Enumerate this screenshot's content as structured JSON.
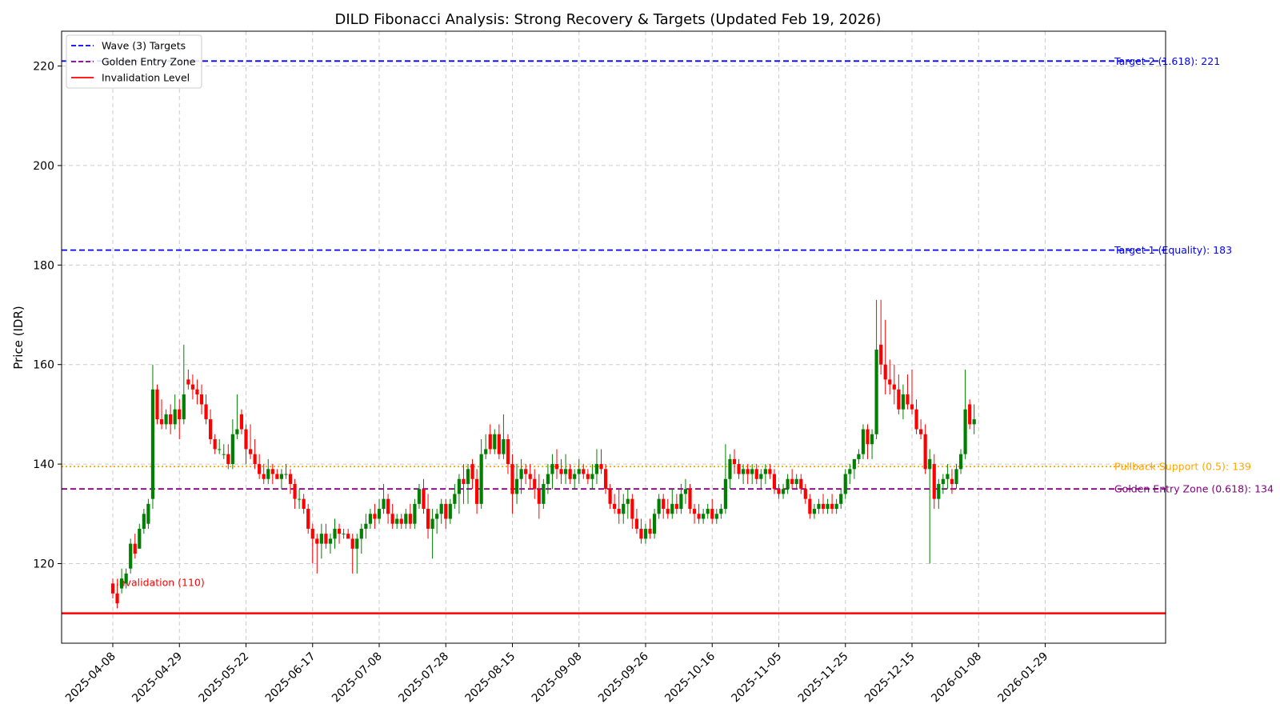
{
  "chart_data": {
    "type": "candlestick",
    "title": "DILD Fibonacci Analysis: Strong Recovery & Targets (Updated Feb 19, 2026)",
    "xlabel": "",
    "ylabel": "Price (IDR)",
    "ylim": [
      104,
      227
    ],
    "yticks": [
      120,
      140,
      160,
      180,
      200,
      220
    ],
    "grid": true,
    "legend_position": "top-left",
    "legend": [
      {
        "label": "Wave (3) Targets",
        "color": "#0000ff",
        "style": "dashed"
      },
      {
        "label": "Golden Entry Zone",
        "color": "#800080",
        "style": "dashed"
      },
      {
        "label": "Invalidation Level",
        "color": "#ff0000",
        "style": "solid"
      }
    ],
    "x_ticks": [
      "2025-04-08",
      "2025-04-29",
      "2025-05-22",
      "2025-06-17",
      "2025-07-08",
      "2025-07-28",
      "2025-08-15",
      "2025-09-08",
      "2025-09-26",
      "2025-10-16",
      "2025-11-05",
      "2025-11-25",
      "2025-12-15",
      "2026-01-08",
      "2026-01-29"
    ],
    "x_tick_trading_index": [
      0,
      15,
      30,
      45,
      60,
      75,
      90,
      105,
      120,
      135,
      150,
      165,
      180,
      195,
      210
    ],
    "horizontal_lines": [
      {
        "value": 221,
        "label": "Target 2 (1.618): 221",
        "color": "#0000ff",
        "style": "dashed"
      },
      {
        "value": 183,
        "label": "Target 1 (Equality): 183",
        "color": "#0000ff",
        "style": "dashed"
      },
      {
        "value": 139.5,
        "label": "Pullback Support (0.5): 139",
        "color": "#ffa500",
        "style": "dotted"
      },
      {
        "value": 135,
        "label": "Golden Entry Zone (0.618): 134",
        "color": "#800080",
        "style": "dashed"
      },
      {
        "value": 110,
        "label": "Invalidation (110)",
        "color": "#ff0000",
        "style": "solid"
      }
    ],
    "colors": {
      "up": "#008000",
      "down": "#ff0000"
    },
    "ohlc": [
      [
        116,
        117,
        113,
        114
      ],
      [
        114,
        116,
        111,
        112
      ],
      [
        115,
        119,
        114,
        117
      ],
      [
        116,
        119,
        115,
        118
      ],
      [
        119,
        125,
        118,
        124
      ],
      [
        124,
        126,
        121,
        122
      ],
      [
        123,
        128,
        123,
        127
      ],
      [
        127,
        131,
        126,
        130
      ],
      [
        128,
        133,
        127,
        132
      ],
      [
        133,
        160,
        131,
        155
      ],
      [
        155,
        156,
        148,
        149
      ],
      [
        149,
        153,
        147,
        148
      ],
      [
        148,
        151,
        147,
        150
      ],
      [
        150,
        152,
        146,
        148
      ],
      [
        148,
        154,
        147,
        151
      ],
      [
        151,
        153,
        145,
        149
      ],
      [
        149,
        164,
        148,
        154
      ],
      [
        157,
        159,
        155,
        156
      ],
      [
        156,
        158,
        153,
        155
      ],
      [
        155,
        157,
        152,
        154
      ],
      [
        154,
        156,
        150,
        152
      ],
      [
        152,
        154,
        148,
        149
      ],
      [
        149,
        151,
        144,
        145
      ],
      [
        145,
        146,
        142,
        143
      ],
      [
        143,
        145,
        142,
        143
      ],
      [
        142,
        144,
        141,
        142
      ],
      [
        142,
        144,
        139,
        140
      ],
      [
        140,
        149,
        139,
        146
      ],
      [
        146,
        154,
        145,
        147
      ],
      [
        150,
        151,
        146,
        147
      ],
      [
        147,
        148,
        140,
        143
      ],
      [
        143,
        148,
        141,
        142
      ],
      [
        142,
        145,
        139,
        140
      ],
      [
        140,
        142,
        137,
        138
      ],
      [
        138,
        140,
        136,
        137
      ],
      [
        137,
        141,
        136,
        139
      ],
      [
        139,
        140,
        136,
        138
      ],
      [
        138,
        139,
        137,
        137
      ],
      [
        137,
        139,
        135,
        138
      ],
      [
        138,
        140,
        137,
        138
      ],
      [
        138,
        139,
        134,
        136
      ],
      [
        136,
        137,
        131,
        133
      ],
      [
        133,
        135,
        131,
        133
      ],
      [
        133,
        134,
        130,
        131
      ],
      [
        131,
        132,
        126,
        127
      ],
      [
        127,
        128,
        120,
        125
      ],
      [
        125,
        126,
        118,
        124
      ],
      [
        124,
        128,
        121,
        126
      ],
      [
        126,
        128,
        123,
        124
      ],
      [
        124,
        126,
        122,
        125
      ],
      [
        125,
        129,
        123,
        127
      ],
      [
        127,
        128,
        124,
        126
      ],
      [
        126,
        127,
        125,
        126
      ],
      [
        126,
        127,
        125,
        125
      ],
      [
        125,
        126,
        118,
        123
      ],
      [
        123,
        126,
        118,
        125
      ],
      [
        125,
        128,
        122,
        127
      ],
      [
        127,
        130,
        125,
        128
      ],
      [
        128,
        131,
        127,
        130
      ],
      [
        130,
        132,
        127,
        129
      ],
      [
        129,
        133,
        128,
        131
      ],
      [
        131,
        136,
        130,
        133
      ],
      [
        133,
        134,
        128,
        130
      ],
      [
        130,
        132,
        127,
        128
      ],
      [
        128,
        130,
        127,
        129
      ],
      [
        129,
        130,
        127,
        128
      ],
      [
        128,
        131,
        127,
        130
      ],
      [
        130,
        132,
        127,
        128
      ],
      [
        128,
        133,
        127,
        132
      ],
      [
        132,
        136,
        131,
        135
      ],
      [
        135,
        137,
        130,
        131
      ],
      [
        131,
        134,
        125,
        127
      ],
      [
        127,
        131,
        121,
        129
      ],
      [
        129,
        131,
        126,
        130
      ],
      [
        130,
        133,
        128,
        132
      ],
      [
        132,
        133,
        127,
        129
      ],
      [
        129,
        133,
        128,
        132
      ],
      [
        132,
        136,
        131,
        134
      ],
      [
        134,
        138,
        130,
        137
      ],
      [
        137,
        140,
        132,
        136
      ],
      [
        136,
        140,
        132,
        139
      ],
      [
        140,
        141,
        135,
        137
      ],
      [
        137,
        139,
        130,
        132
      ],
      [
        132,
        145,
        131,
        142
      ],
      [
        142,
        146,
        141,
        143
      ],
      [
        146,
        148,
        142,
        143
      ],
      [
        143,
        147,
        142,
        146
      ],
      [
        146,
        148,
        141,
        142
      ],
      [
        142,
        150,
        141,
        145
      ],
      [
        145,
        146,
        138,
        140
      ],
      [
        140,
        142,
        130,
        134
      ],
      [
        134,
        140,
        132,
        137
      ],
      [
        137,
        141,
        134,
        139
      ],
      [
        139,
        140,
        136,
        138
      ],
      [
        138,
        140,
        135,
        137
      ],
      [
        137,
        139,
        133,
        135
      ],
      [
        135,
        138,
        129,
        132
      ],
      [
        132,
        137,
        131,
        136
      ],
      [
        136,
        140,
        134,
        138
      ],
      [
        138,
        142,
        135,
        140
      ],
      [
        140,
        143,
        137,
        139
      ],
      [
        139,
        141,
        136,
        138
      ],
      [
        138,
        142,
        136,
        139
      ],
      [
        139,
        140,
        136,
        137
      ],
      [
        137,
        139,
        135,
        138
      ],
      [
        138,
        141,
        136,
        139
      ],
      [
        139,
        140,
        137,
        138
      ],
      [
        138,
        139,
        136,
        137
      ],
      [
        137,
        140,
        135,
        138
      ],
      [
        138,
        143,
        136,
        140
      ],
      [
        140,
        143,
        138,
        139
      ],
      [
        139,
        140,
        134,
        135
      ],
      [
        135,
        136,
        131,
        132
      ],
      [
        132,
        134,
        130,
        131
      ],
      [
        131,
        135,
        128,
        130
      ],
      [
        130,
        134,
        128,
        132
      ],
      [
        132,
        135,
        129,
        133
      ],
      [
        133,
        134,
        127,
        129
      ],
      [
        129,
        131,
        126,
        127
      ],
      [
        127,
        129,
        124,
        125
      ],
      [
        125,
        128,
        124,
        127
      ],
      [
        127,
        129,
        125,
        126
      ],
      [
        126,
        131,
        125,
        130
      ],
      [
        130,
        134,
        129,
        133
      ],
      [
        133,
        134,
        129,
        131
      ],
      [
        131,
        133,
        129,
        130
      ],
      [
        130,
        135,
        129,
        132
      ],
      [
        132,
        134,
        130,
        131
      ],
      [
        131,
        136,
        130,
        134
      ],
      [
        134,
        137,
        132,
        135
      ],
      [
        135,
        136,
        130,
        131
      ],
      [
        131,
        132,
        128,
        130
      ],
      [
        130,
        132,
        128,
        129
      ],
      [
        129,
        131,
        128,
        130
      ],
      [
        130,
        132,
        129,
        131
      ],
      [
        131,
        133,
        128,
        129
      ],
      [
        129,
        131,
        128,
        130
      ],
      [
        130,
        132,
        129,
        131
      ],
      [
        131,
        144,
        130,
        137
      ],
      [
        137,
        142,
        135,
        141
      ],
      [
        141,
        143,
        138,
        140
      ],
      [
        140,
        141,
        137,
        138
      ],
      [
        138,
        140,
        136,
        139
      ],
      [
        139,
        140,
        136,
        138
      ],
      [
        138,
        140,
        136,
        139
      ],
      [
        139,
        140,
        136,
        137
      ],
      [
        137,
        139,
        135,
        138
      ],
      [
        138,
        140,
        136,
        139
      ],
      [
        139,
        140,
        137,
        138
      ],
      [
        138,
        139,
        134,
        135
      ],
      [
        135,
        136,
        133,
        134
      ],
      [
        134,
        136,
        133,
        135
      ],
      [
        135,
        138,
        134,
        137
      ],
      [
        137,
        139,
        135,
        136
      ],
      [
        136,
        138,
        135,
        137
      ],
      [
        137,
        138,
        134,
        135
      ],
      [
        135,
        136,
        132,
        133
      ],
      [
        133,
        134,
        129,
        130
      ],
      [
        130,
        132,
        129,
        131
      ],
      [
        131,
        133,
        130,
        132
      ],
      [
        132,
        134,
        130,
        131
      ],
      [
        131,
        133,
        130,
        132
      ],
      [
        132,
        134,
        130,
        131
      ],
      [
        131,
        133,
        130,
        132
      ],
      [
        132,
        135,
        131,
        134
      ],
      [
        134,
        139,
        133,
        138
      ],
      [
        138,
        140,
        136,
        139
      ],
      [
        139,
        141,
        137,
        141
      ],
      [
        141,
        143,
        140,
        142
      ],
      [
        142,
        148,
        141,
        147
      ],
      [
        147,
        148,
        141,
        144
      ],
      [
        144,
        147,
        141,
        146
      ],
      [
        146,
        173,
        145,
        163
      ],
      [
        164,
        173,
        158,
        160
      ],
      [
        160,
        169,
        154,
        157
      ],
      [
        157,
        161,
        154,
        156
      ],
      [
        156,
        160,
        152,
        155
      ],
      [
        155,
        158,
        150,
        151
      ],
      [
        151,
        156,
        149,
        154
      ],
      [
        154,
        158,
        151,
        152
      ],
      [
        152,
        159,
        150,
        151
      ],
      [
        151,
        153,
        146,
        147
      ],
      [
        147,
        149,
        145,
        146
      ],
      [
        146,
        148,
        138,
        139
      ],
      [
        139,
        143,
        120,
        141
      ],
      [
        140,
        142,
        131,
        133
      ],
      [
        133,
        137,
        131,
        136
      ],
      [
        136,
        138,
        134,
        137
      ],
      [
        137,
        140,
        135,
        138
      ],
      [
        137,
        139,
        134,
        136
      ],
      [
        136,
        140,
        135,
        139
      ],
      [
        139,
        143,
        138,
        142
      ],
      [
        142,
        159,
        141,
        151
      ],
      [
        152,
        153,
        147,
        148
      ],
      [
        148,
        152,
        146,
        149
      ]
    ],
    "trading_index": [
      0,
      1,
      2,
      3,
      4,
      5,
      6,
      7,
      8,
      9,
      10,
      11,
      12,
      13,
      14,
      15,
      16,
      17,
      18,
      19,
      20,
      21,
      22,
      23,
      24,
      25,
      26,
      27,
      28,
      29,
      30,
      31,
      32,
      33,
      34,
      35,
      36,
      37,
      38,
      39,
      40,
      41,
      42,
      43,
      44,
      45,
      46,
      47,
      48,
      49,
      50,
      51,
      52,
      53,
      54,
      55,
      56,
      57,
      58,
      59,
      60,
      61,
      62,
      63,
      64,
      65,
      66,
      67,
      68,
      69,
      70,
      71,
      72,
      73,
      74,
      75,
      76,
      77,
      78,
      79,
      80,
      81,
      82,
      83,
      84,
      85,
      86,
      87,
      88,
      89,
      90,
      91,
      92,
      93,
      94,
      95,
      96,
      97,
      98,
      99,
      100,
      101,
      102,
      103,
      104,
      105,
      106,
      107,
      108,
      109,
      110,
      111,
      112,
      113,
      114,
      115,
      116,
      117,
      118,
      119,
      120,
      121,
      122,
      123,
      124,
      125,
      126,
      127,
      128,
      129,
      130,
      131,
      132,
      133,
      134,
      135,
      136,
      137,
      138,
      139,
      140,
      141,
      142,
      143,
      144,
      145,
      146,
      147,
      148,
      149,
      150,
      151,
      152,
      153,
      154,
      155,
      156,
      157,
      158,
      159,
      160,
      161,
      162,
      163,
      164,
      165,
      166,
      167,
      168,
      169,
      170,
      171,
      172,
      173,
      174,
      175,
      176,
      177,
      178,
      179,
      180,
      181,
      182,
      183,
      184,
      185,
      186,
      187,
      188,
      189,
      190,
      191,
      192,
      193,
      194,
      195,
      196,
      197,
      198,
      199,
      200,
      201,
      202,
      203,
      204,
      205,
      206,
      207,
      208,
      209,
      210,
      211,
      212,
      213,
      214,
      215,
      216,
      217,
      218,
      219,
      220,
      221,
      222,
      223,
      224
    ]
  }
}
